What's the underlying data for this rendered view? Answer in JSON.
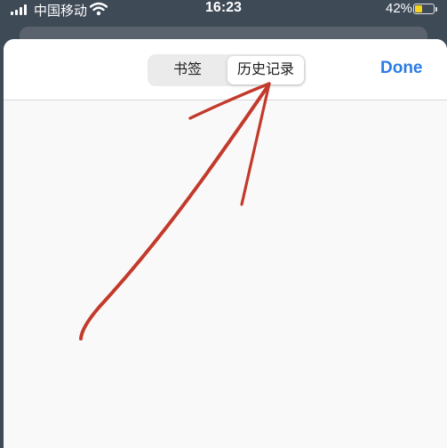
{
  "status_bar": {
    "carrier": "中国移动",
    "time": "16:23",
    "battery_percent": "42%",
    "battery_level": 0.42,
    "battery_color": "#f5d31e"
  },
  "nav": {
    "tabs": [
      {
        "label": "书签",
        "selected": false
      },
      {
        "label": "历史记录",
        "selected": true
      }
    ],
    "done_label": "Done",
    "accent_color": "#2b7be6"
  },
  "annotation": {
    "kind": "hand-drawn arrow",
    "color": "#c23a2b"
  }
}
